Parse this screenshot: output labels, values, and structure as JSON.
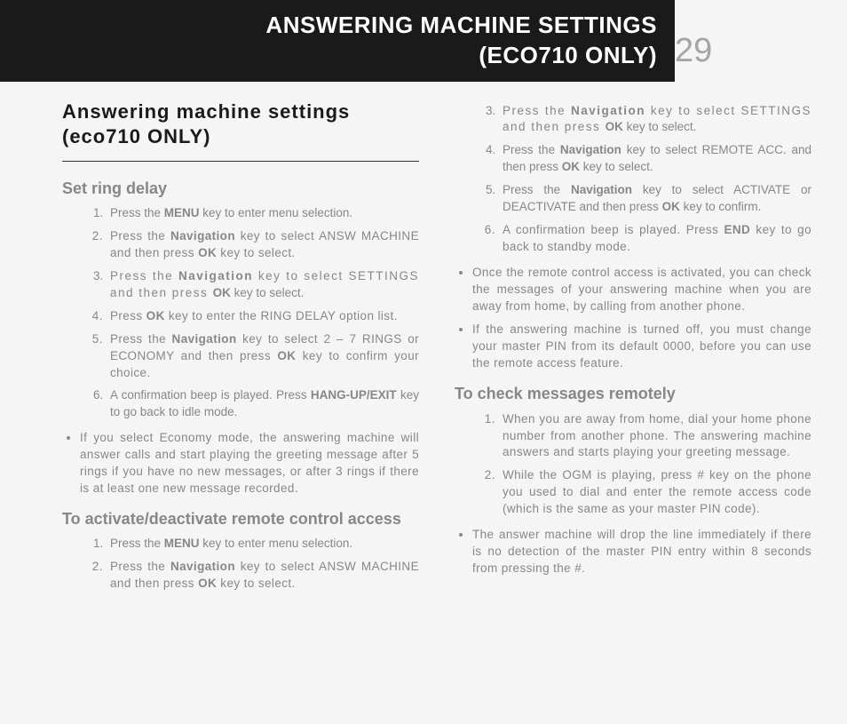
{
  "header": {
    "line1": "ANSWERING MACHINE SETTINGS",
    "line2": "(ECO710 ONLY)",
    "page_number": "29"
  },
  "main_title": "Answering machine settings (eco710 ONLY)",
  "left": {
    "section1": {
      "title": "Set ring delay",
      "steps": {
        "s1a": "Press the ",
        "s1b": "MENU",
        "s1c": " key to enter menu selection.",
        "s2a": "Press the ",
        "s2b": "Navigation",
        "s2c": " key to select ANSW MACHINE and then press ",
        "s2d": "OK",
        "s2e": " key to select.",
        "s3a": "Press the ",
        "s3b": "Navigation",
        "s3c": " key to select SETTINGS and then press ",
        "s3d": "OK",
        "s3e": " key to select.",
        "s4a": "Press ",
        "s4b": "OK",
        "s4c": " key to enter the RING DELAY option list.",
        "s5a": "Press the ",
        "s5b": "Navigation",
        "s5c": " key to select 2 – 7 RINGS or ECONOMY and then press ",
        "s5d": "OK",
        "s5e": " key to confirm your choice.",
        "s6a": "A confirmation beep is played. Press ",
        "s6b": "HANG-UP/EXIT",
        "s6c": " key to go back to idle mode."
      },
      "note": "If you select Economy mode, the answering machine will answer calls and start playing the greeting message after 5 rings if you have no new messages, or after 3 rings if there is at least one new message recorded."
    },
    "section2": {
      "title": "To activate/deactivate remote control access",
      "steps": {
        "s1a": "Press the ",
        "s1b": "MENU",
        "s1c": " key to enter menu selection.",
        "s2a": "Press the ",
        "s2b": "Navigation",
        "s2c": " key to select ANSW MACHINE and then press ",
        "s2d": "OK",
        "s2e": " key to select."
      }
    }
  },
  "right": {
    "cont_steps": {
      "s3a": "Press the ",
      "s3b": "Navigation",
      "s3c": " key to select SETTINGS and then press ",
      "s3d": "OK",
      "s3e": " key to select.",
      "s4a": "Press the ",
      "s4b": "Navigation",
      "s4c": " key to select REMOTE ACC. and then press ",
      "s4d": "OK",
      "s4e": " key to select.",
      "s5a": "Press the ",
      "s5b": "Navigation",
      "s5c": " key to select ACTIVATE or DEACTIVATE and then press ",
      "s5d": "OK",
      "s5e": " key to confirm.",
      "s6a": "A confirmation beep is played. Press ",
      "s6b": "END",
      "s6c": " key to go back to standby mode."
    },
    "notes": {
      "n1": "Once the remote control access is activated, you can check the messages of your answering machine when you are away from home, by calling from another phone.",
      "n2": "If the answering machine is turned off, you must change your master PIN from its default 0000, before you can use the remote access feature."
    },
    "section3": {
      "title": "To check messages remotely",
      "steps": {
        "s1": "When you are away from home, dial your home phone number from another phone. The answering machine answers and starts playing your greeting message.",
        "s2": "While the OGM is playing, press # key on the phone you used to dial and enter the remote access code (which is the same as your master PIN code)."
      },
      "note": "The answer machine will drop the line immediately if there is no detection of the master PIN entry within 8 seconds from pressing the #."
    }
  }
}
